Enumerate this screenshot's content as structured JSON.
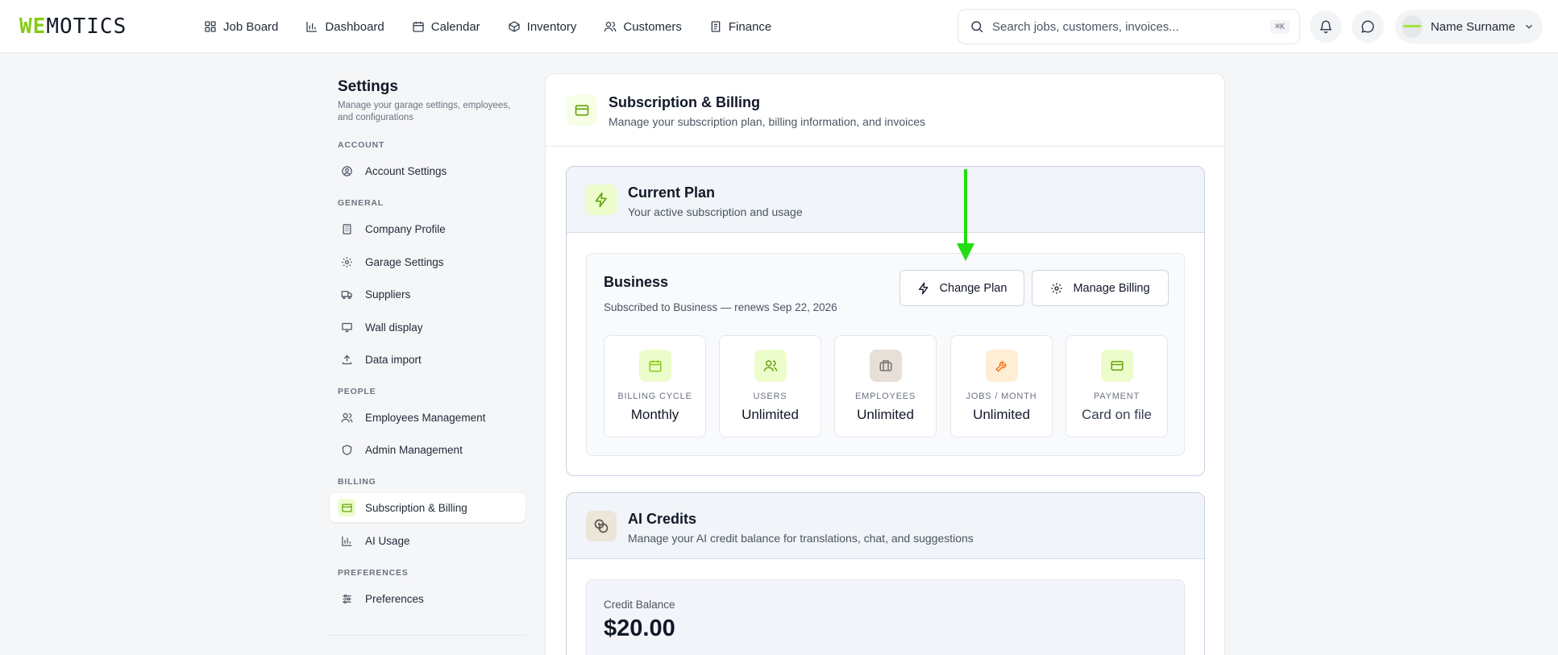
{
  "brand": {
    "logo_part1": "WE",
    "logo_part2": "MOTICS",
    "accent_color": "#84cc16"
  },
  "nav": {
    "items": [
      {
        "label": "Job Board",
        "icon": "grid-icon"
      },
      {
        "label": "Dashboard",
        "icon": "bar-chart-icon"
      },
      {
        "label": "Calendar",
        "icon": "calendar-icon"
      },
      {
        "label": "Inventory",
        "icon": "box-icon"
      },
      {
        "label": "Customers",
        "icon": "users-icon"
      },
      {
        "label": "Finance",
        "icon": "receipt-icon"
      }
    ]
  },
  "search": {
    "placeholder": "Search jobs, customers, invoices...",
    "shortcut": "⌘K"
  },
  "user": {
    "name": "Name Surname"
  },
  "sidebar": {
    "title": "Settings",
    "description": "Manage your garage settings, employees, and configurations",
    "sections": [
      {
        "label": "ACCOUNT",
        "items": [
          {
            "label": "Account Settings",
            "icon": "user-circle-icon"
          }
        ]
      },
      {
        "label": "GENERAL",
        "items": [
          {
            "label": "Company Profile",
            "icon": "building-icon"
          },
          {
            "label": "Garage Settings",
            "icon": "gear-icon"
          },
          {
            "label": "Suppliers",
            "icon": "truck-icon"
          },
          {
            "label": "Wall display",
            "icon": "monitor-icon"
          },
          {
            "label": "Data import",
            "icon": "upload-icon"
          }
        ]
      },
      {
        "label": "PEOPLE",
        "items": [
          {
            "label": "Employees Management",
            "icon": "users-icon"
          },
          {
            "label": "Admin Management",
            "icon": "shield-icon"
          }
        ]
      },
      {
        "label": "BILLING",
        "items": [
          {
            "label": "Subscription & Billing",
            "icon": "credit-card-icon",
            "active": true
          },
          {
            "label": "AI Usage",
            "icon": "bar-chart-icon"
          }
        ]
      },
      {
        "label": "PREFERENCES",
        "items": [
          {
            "label": "Preferences",
            "icon": "sliders-icon"
          }
        ]
      }
    ]
  },
  "main": {
    "title": "Subscription & Billing",
    "subtitle": "Manage your subscription plan, billing information, and invoices",
    "current_plan": {
      "title": "Current Plan",
      "subtitle": "Your active subscription and usage",
      "plan_name": "Business",
      "renewal": "Subscribed to Business — renews Sep 22, 2026",
      "change_plan_label": "Change Plan",
      "manage_billing_label": "Manage Billing",
      "stats": [
        {
          "label": "BILLING CYCLE",
          "value": "Monthly",
          "icon": "calendar-icon",
          "color": "#84cc16",
          "bg": "#ecfccb"
        },
        {
          "label": "USERS",
          "value": "Unlimited",
          "icon": "users-icon",
          "color": "#65a30d",
          "bg": "#ecfccb"
        },
        {
          "label": "EMPLOYEES",
          "value": "Unlimited",
          "icon": "briefcase-icon",
          "color": "#78716c",
          "bg": "#e7e0d8"
        },
        {
          "label": "JOBS / MONTH",
          "value": "Unlimited",
          "icon": "wrench-icon",
          "color": "#f97316",
          "bg": "#ffedd5"
        },
        {
          "label": "PAYMENT",
          "value": "Card on file",
          "icon": "credit-card-icon",
          "color": "#65a30d",
          "bg": "#ecfccb"
        }
      ]
    },
    "ai_credits": {
      "title": "AI Credits",
      "subtitle": "Manage your AI credit balance for translations, chat, and suggestions",
      "balance_label": "Credit Balance",
      "balance_value": "$20.00"
    }
  },
  "annotation": {
    "arrow_color": "#22dd11"
  }
}
